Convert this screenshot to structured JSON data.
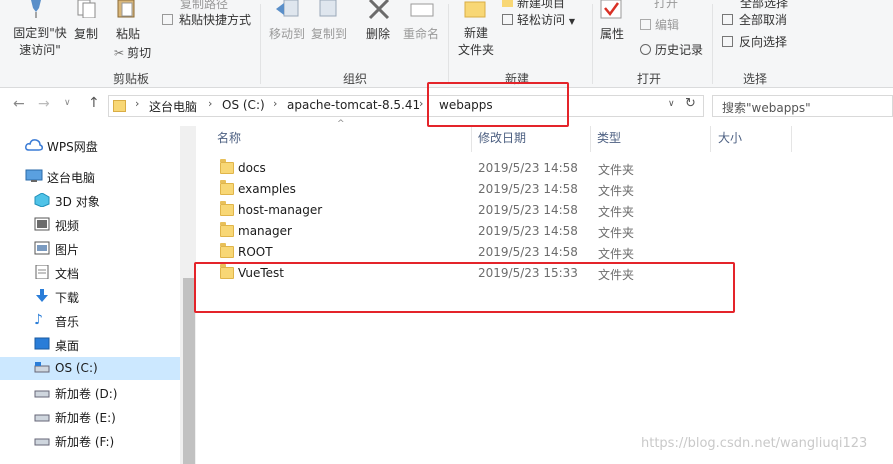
{
  "ribbon": {
    "pin_label_1": "固定到\"快",
    "pin_label_2": "速访问\"",
    "copy_label": "复制",
    "paste_label": "粘贴",
    "copy_path": "复制路径",
    "paste_shortcut": "粘贴快捷方式",
    "cut": "剪切",
    "clipboard_group": "剪贴板",
    "move_to": "移动到",
    "copy_to": "复制到",
    "delete": "删除",
    "rename": "重命名",
    "organize_group": "组织",
    "new_folder_1": "新建",
    "new_folder_2": "文件夹",
    "new_item": "新建项目",
    "easy_access": "轻松访问",
    "new_group": "新建",
    "properties": "属性",
    "open": "打开",
    "edit": "编辑",
    "history": "历史记录",
    "open_group": "打开",
    "select_all": "全部选择",
    "select_none": "全部取消",
    "invert_select": "反向选择",
    "select_group": "选择"
  },
  "address": {
    "crumbs": [
      "这台电脑",
      "OS (C:)",
      "apache-tomcat-8.5.41",
      "webapps"
    ]
  },
  "search": {
    "placeholder": "搜索\"webapps\""
  },
  "sidebar": {
    "items": [
      {
        "label": "WPS网盘",
        "icon": "cloud-icon"
      },
      {
        "label": "这台电脑",
        "icon": "computer-icon"
      },
      {
        "label": "3D 对象",
        "icon": "cube-icon"
      },
      {
        "label": "视频",
        "icon": "video-icon"
      },
      {
        "label": "图片",
        "icon": "picture-icon"
      },
      {
        "label": "文档",
        "icon": "document-icon"
      },
      {
        "label": "下载",
        "icon": "download-icon"
      },
      {
        "label": "音乐",
        "icon": "music-icon"
      },
      {
        "label": "桌面",
        "icon": "desktop-icon"
      },
      {
        "label": "OS (C:)",
        "icon": "drive-icon"
      },
      {
        "label": "新加卷 (D:)",
        "icon": "drive-icon"
      },
      {
        "label": "新加卷 (E:)",
        "icon": "drive-icon"
      },
      {
        "label": "新加卷 (F:)",
        "icon": "drive-icon"
      }
    ]
  },
  "columns": {
    "name": "名称",
    "date": "修改日期",
    "type": "类型",
    "size": "大小"
  },
  "files": [
    {
      "name": "docs",
      "date": "2019/5/23 14:58",
      "type": "文件夹"
    },
    {
      "name": "examples",
      "date": "2019/5/23 14:58",
      "type": "文件夹"
    },
    {
      "name": "host-manager",
      "date": "2019/5/23 14:58",
      "type": "文件夹"
    },
    {
      "name": "manager",
      "date": "2019/5/23 14:58",
      "type": "文件夹"
    },
    {
      "name": "ROOT",
      "date": "2019/5/23 14:58",
      "type": "文件夹"
    },
    {
      "name": "VueTest",
      "date": "2019/5/23 15:33",
      "type": "文件夹"
    }
  ],
  "watermark": "https://blog.csdn.net/wangliuqi123",
  "colors": {
    "highlight": "#e4242a",
    "selected": "#cce8ff"
  }
}
